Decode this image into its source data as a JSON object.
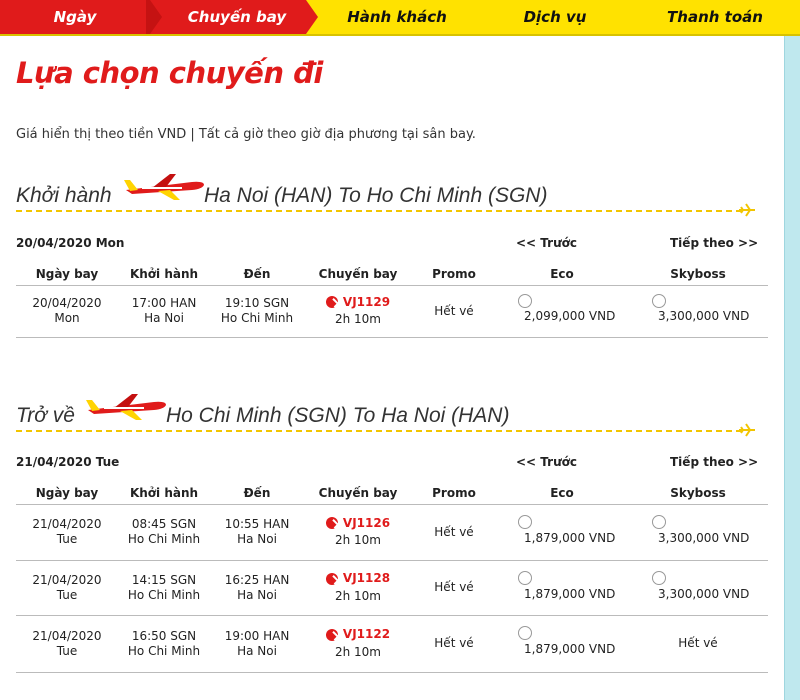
{
  "steps": [
    {
      "label": "Ngày",
      "state": "done"
    },
    {
      "label": "Chuyến bay",
      "state": "current"
    },
    {
      "label": "Hành khách",
      "state": "todo"
    },
    {
      "label": "Dịch vụ",
      "state": "todo"
    },
    {
      "label": "Thanh toán",
      "state": "todo"
    }
  ],
  "page": {
    "title": "Lựa chọn chuyến đi",
    "subtitle": "Giá hiển thị theo tiền VND | Tất cả giờ theo giờ địa phương tại sân bay."
  },
  "colors": {
    "brand_red": "#e01b1b",
    "brand_yellow": "#ffe200",
    "dash_yellow": "#f2c500"
  },
  "columns": [
    "Ngày bay",
    "Khởi hành",
    "Đến",
    "Chuyến bay",
    "Promo",
    "Eco",
    "Skyboss"
  ],
  "sections": [
    {
      "label": "Khởi hành",
      "route": "Ha Noi (HAN) To Ho Chi Minh (SGN)",
      "date": "20/04/2020 Mon",
      "prev": "<< Trước",
      "next": "Tiếp theo >>",
      "flights": [
        {
          "date": "20/04/2020",
          "day": "Mon",
          "dep_time": "17:00 HAN",
          "dep_city": "Ha Noi",
          "arr_time": "19:10 SGN",
          "arr_city": "Ho Chi Minh",
          "flight_no": "VJ1129",
          "duration": "2h 10m",
          "promo": "Hết vé",
          "eco": "2,099,000 VND",
          "skyboss": "3,300,000 VND"
        }
      ]
    },
    {
      "label": "Trở về",
      "route": "Ho Chi Minh (SGN) To Ha Noi (HAN)",
      "date": "21/04/2020 Tue",
      "prev": "<< Trước",
      "next": "Tiếp theo >>",
      "flights": [
        {
          "date": "21/04/2020",
          "day": "Tue",
          "dep_time": "08:45 SGN",
          "dep_city": "Ho Chi Minh",
          "arr_time": "10:55 HAN",
          "arr_city": "Ha Noi",
          "flight_no": "VJ1126",
          "duration": "2h 10m",
          "promo": "Hết vé",
          "eco": "1,879,000 VND",
          "skyboss": "3,300,000 VND"
        },
        {
          "date": "21/04/2020",
          "day": "Tue",
          "dep_time": "14:15 SGN",
          "dep_city": "Ho Chi Minh",
          "arr_time": "16:25 HAN",
          "arr_city": "Ha Noi",
          "flight_no": "VJ1128",
          "duration": "2h 10m",
          "promo": "Hết vé",
          "eco": "1,879,000 VND",
          "skyboss": "3,300,000 VND"
        },
        {
          "date": "21/04/2020",
          "day": "Tue",
          "dep_time": "16:50 SGN",
          "dep_city": "Ho Chi Minh",
          "arr_time": "19:00 HAN",
          "arr_city": "Ha Noi",
          "flight_no": "VJ1122",
          "duration": "2h 10m",
          "promo": "Hết vé",
          "eco": "1,879,000 VND",
          "skyboss": "Hết vé"
        }
      ]
    }
  ]
}
